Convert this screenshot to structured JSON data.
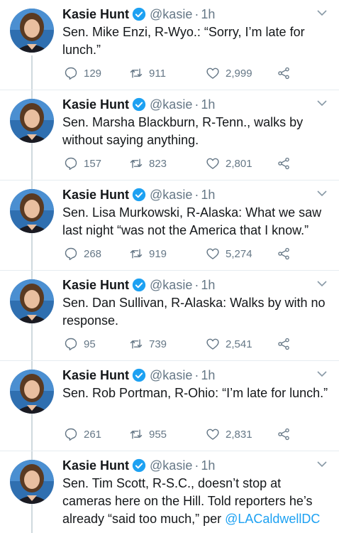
{
  "tweets": [
    {
      "name": "Kasie Hunt",
      "handle": "@kasie",
      "separator": "·",
      "time": "1h",
      "text": "Sen. Mike Enzi, R-Wyo.: “Sorry, I’m late for lunch.”",
      "reply_count": "129",
      "retweet_count": "911",
      "like_count": "2,999"
    },
    {
      "name": "Kasie Hunt",
      "handle": "@kasie",
      "separator": "·",
      "time": "1h",
      "text": "Sen. Marsha Blackburn, R-Tenn., walks by without saying anything.",
      "reply_count": "157",
      "retweet_count": "823",
      "like_count": "2,801"
    },
    {
      "name": "Kasie Hunt",
      "handle": "@kasie",
      "separator": "·",
      "time": "1h",
      "text": "Sen. Lisa Murkowski, R-Alaska: What we saw last night “was not the America that I know.”",
      "reply_count": "268",
      "retweet_count": "919",
      "like_count": "5,274"
    },
    {
      "name": "Kasie Hunt",
      "handle": "@kasie",
      "separator": "·",
      "time": "1h",
      "text": "Sen. Dan Sullivan, R-Alaska: Walks by with no response.",
      "reply_count": "95",
      "retweet_count": "739",
      "like_count": "2,541"
    },
    {
      "name": "Kasie Hunt",
      "handle": "@kasie",
      "separator": "·",
      "time": "1h",
      "text": "Sen. Rob Portman, R-Ohio: “I’m late for lunch.”",
      "reply_count": "261",
      "retweet_count": "955",
      "like_count": "2,831"
    },
    {
      "name": "Kasie Hunt",
      "handle": "@kasie",
      "separator": "·",
      "time": "1h",
      "text": "Sen. Tim Scott, R-S.C., doesn’t stop at cameras here on the Hill. Told reporters he’s already “said too much,” per ",
      "mention": "@LACaldwellDC"
    }
  ],
  "icons": {
    "avatar": "avatar-photo",
    "verified": "verified-badge-icon",
    "caret": "chevron-down-icon",
    "reply": "reply-icon",
    "retweet": "retweet-icon",
    "like": "heart-icon",
    "share": "share-icon"
  },
  "colors": {
    "text": "#14171a",
    "secondary": "#657786",
    "link": "#1da1f2",
    "verified": "#1da1f2"
  }
}
